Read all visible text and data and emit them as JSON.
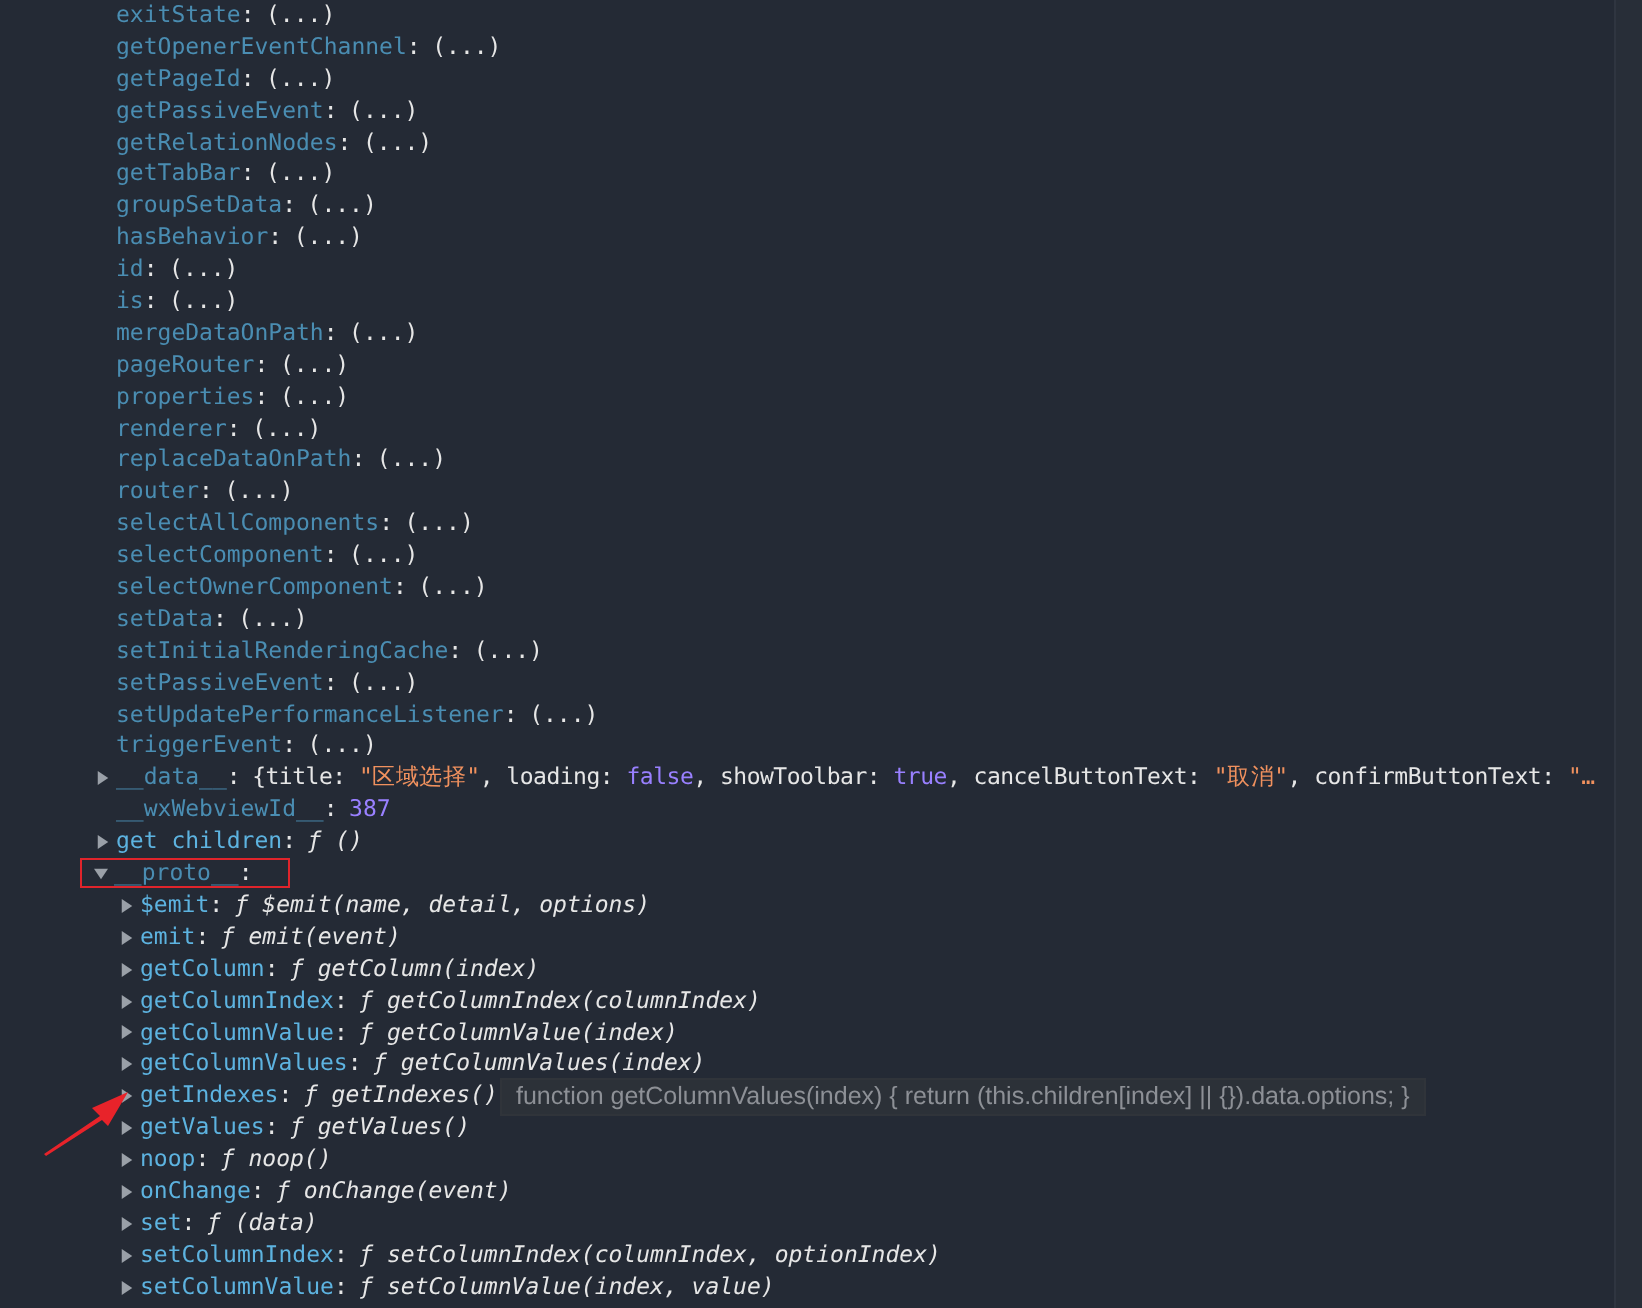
{
  "properties": [
    {
      "name": "exitState",
      "sep": ":",
      "dimmed": true,
      "kind": "lazy",
      "value": "(...)"
    },
    {
      "name": "getOpenerEventChannel",
      "sep": ":",
      "dimmed": true,
      "kind": "lazy",
      "value": "(...)"
    },
    {
      "name": "getPageId",
      "sep": ":",
      "dimmed": true,
      "kind": "lazy",
      "value": "(...)"
    },
    {
      "name": "getPassiveEvent",
      "sep": ":",
      "dimmed": true,
      "kind": "lazy",
      "value": "(...)"
    },
    {
      "name": "getRelationNodes",
      "sep": ":",
      "dimmed": true,
      "kind": "lazy",
      "value": "(...)"
    },
    {
      "name": "getTabBar",
      "sep": ":",
      "dimmed": true,
      "kind": "lazy",
      "value": "(...)"
    },
    {
      "name": "groupSetData",
      "sep": ":",
      "dimmed": true,
      "kind": "lazy",
      "value": "(...)"
    },
    {
      "name": "hasBehavior",
      "sep": ":",
      "dimmed": true,
      "kind": "lazy",
      "value": "(...)"
    },
    {
      "name": "id",
      "sep": ":",
      "dimmed": true,
      "kind": "lazy",
      "value": "(...)"
    },
    {
      "name": "is",
      "sep": ":",
      "dimmed": true,
      "kind": "lazy",
      "value": "(...)"
    },
    {
      "name": "mergeDataOnPath",
      "sep": ":",
      "dimmed": true,
      "kind": "lazy",
      "value": "(...)"
    },
    {
      "name": "pageRouter",
      "sep": ":",
      "dimmed": true,
      "kind": "lazy",
      "value": "(...)"
    },
    {
      "name": "properties",
      "sep": ":",
      "dimmed": true,
      "kind": "lazy",
      "value": "(...)"
    },
    {
      "name": "renderer",
      "sep": ":",
      "dimmed": true,
      "kind": "lazy",
      "value": "(...)"
    },
    {
      "name": "replaceDataOnPath",
      "sep": ":",
      "dimmed": true,
      "kind": "lazy",
      "value": "(...)"
    },
    {
      "name": "router",
      "sep": ":",
      "dimmed": true,
      "kind": "lazy",
      "value": "(...)"
    },
    {
      "name": "selectAllComponents",
      "sep": ":",
      "dimmed": true,
      "kind": "lazy",
      "value": "(...)"
    },
    {
      "name": "selectComponent",
      "sep": ":",
      "dimmed": true,
      "kind": "lazy",
      "value": "(...)"
    },
    {
      "name": "selectOwnerComponent",
      "sep": ":",
      "dimmed": true,
      "kind": "lazy",
      "value": "(...)"
    },
    {
      "name": "setData",
      "sep": ":",
      "dimmed": true,
      "kind": "lazy",
      "value": "(...)"
    },
    {
      "name": "setInitialRenderingCache",
      "sep": ":",
      "dimmed": true,
      "kind": "lazy",
      "value": "(...)"
    },
    {
      "name": "setPassiveEvent",
      "sep": ":",
      "dimmed": true,
      "kind": "lazy",
      "value": "(...)"
    },
    {
      "name": "setUpdatePerformanceListener",
      "sep": ":",
      "dimmed": true,
      "kind": "lazy",
      "value": "(...)"
    },
    {
      "name": "triggerEvent",
      "sep": ":",
      "dimmed": true,
      "kind": "lazy",
      "value": "(...)"
    },
    {
      "name": "__data__",
      "sep": ":",
      "dimmed": true,
      "kind": "preview",
      "expanded": false,
      "parts": [
        {
          "kind": "plain",
          "text": "{title: "
        },
        {
          "kind": "string",
          "text": "\"区域选择\""
        },
        {
          "kind": "plain",
          "text": ", loading: "
        },
        {
          "kind": "keyword",
          "text": "false"
        },
        {
          "kind": "plain",
          "text": ", showToolbar: "
        },
        {
          "kind": "keyword",
          "text": "true"
        },
        {
          "kind": "plain",
          "text": ", cancelButtonText: "
        },
        {
          "kind": "string",
          "text": "\"取消\""
        },
        {
          "kind": "plain",
          "text": ", confirmButtonText: "
        },
        {
          "kind": "string",
          "text": "\"…"
        }
      ]
    },
    {
      "name": "__wxWebviewId__",
      "sep": ":",
      "dimmed": true,
      "kind": "number",
      "value": "387"
    },
    {
      "name": "get children",
      "sep": ":",
      "dimmed": false,
      "kind": "function",
      "expanded": false,
      "value": "ƒ ()"
    },
    {
      "name": "__proto__",
      "sep": ":",
      "dimmed": true,
      "kind": "object",
      "expanded": true,
      "highlighted": true,
      "children": [
        {
          "name": "$emit",
          "sep": ":",
          "dimmed": false,
          "kind": "function",
          "expanded": false,
          "value": "ƒ $emit(name, detail, options)"
        },
        {
          "name": "emit",
          "sep": ":",
          "dimmed": false,
          "kind": "function",
          "expanded": false,
          "value": "ƒ emit(event)"
        },
        {
          "name": "getColumn",
          "sep": ":",
          "dimmed": false,
          "kind": "function",
          "expanded": false,
          "value": "ƒ getColumn(index)"
        },
        {
          "name": "getColumnIndex",
          "sep": ":",
          "dimmed": false,
          "kind": "function",
          "expanded": false,
          "value": "ƒ getColumnIndex(columnIndex)"
        },
        {
          "name": "getColumnValue",
          "sep": ":",
          "dimmed": false,
          "kind": "function",
          "expanded": false,
          "value": "ƒ getColumnValue(index)"
        },
        {
          "name": "getColumnValues",
          "sep": ":",
          "dimmed": false,
          "kind": "function",
          "expanded": false,
          "value": "ƒ getColumnValues(index)"
        },
        {
          "name": "getIndexes",
          "sep": ":",
          "dimmed": false,
          "kind": "function",
          "expanded": false,
          "value": "ƒ getIndexes()",
          "tooltip": "function getColumnValues(index) { return (this.children[index] || {}).data.options; }"
        },
        {
          "name": "getValues",
          "sep": ":",
          "dimmed": false,
          "kind": "function",
          "expanded": false,
          "value": "ƒ getValues()"
        },
        {
          "name": "noop",
          "sep": ":",
          "dimmed": false,
          "kind": "function",
          "expanded": false,
          "value": "ƒ noop()"
        },
        {
          "name": "onChange",
          "sep": ":",
          "dimmed": false,
          "kind": "function",
          "expanded": false,
          "value": "ƒ onChange(event)"
        },
        {
          "name": "set",
          "sep": ":",
          "dimmed": false,
          "kind": "function",
          "expanded": false,
          "value": "ƒ (data)"
        },
        {
          "name": "setColumnIndex",
          "sep": ":",
          "dimmed": false,
          "kind": "function",
          "expanded": false,
          "value": "ƒ setColumnIndex(columnIndex, optionIndex)"
        },
        {
          "name": "setColumnValue",
          "sep": ":",
          "dimmed": false,
          "kind": "function",
          "expanded": false,
          "value": "ƒ setColumnValue(index, value)"
        }
      ]
    }
  ]
}
